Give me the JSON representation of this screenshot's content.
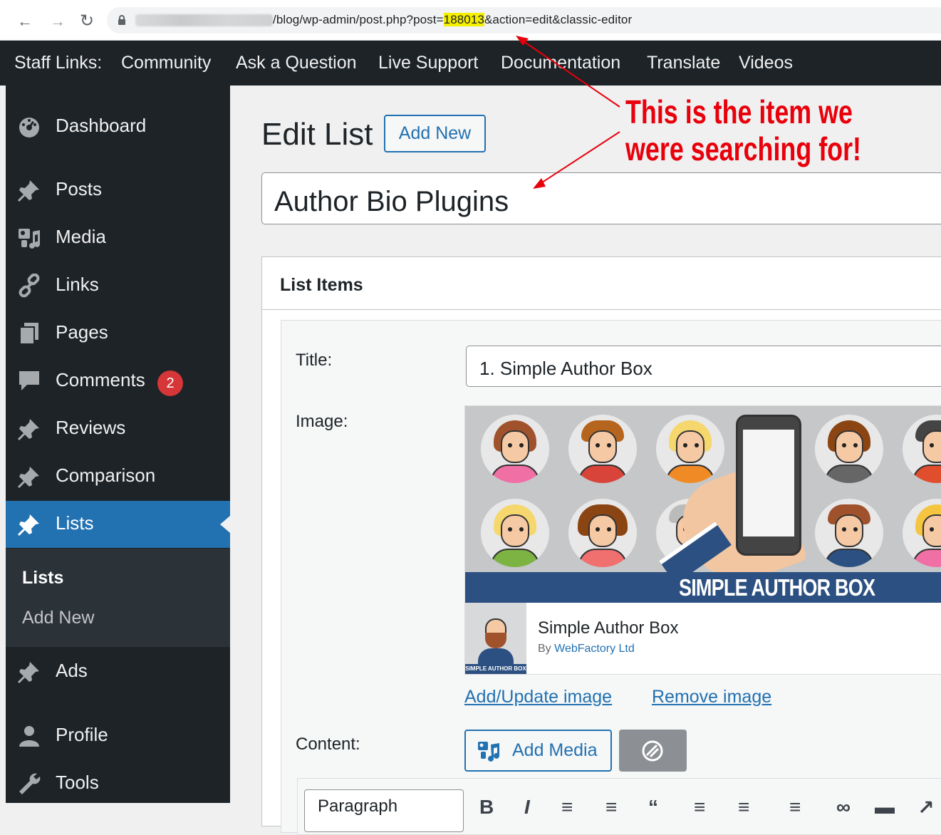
{
  "browser": {
    "back_icon": "arrow-left-icon",
    "forward_icon": "arrow-right-icon",
    "reload_icon": "reload-icon",
    "url_path": "/blog/wp-admin/post.php?post=",
    "url_post_id": "188013",
    "url_query": "&action=edit&classic-editor"
  },
  "adminbar": {
    "items": [
      "Staff Links:",
      "Community",
      "Ask a Question",
      "Live Support",
      "Documentation",
      "Translate",
      "Videos"
    ]
  },
  "sidebar": {
    "items": [
      {
        "label": "Dashboard",
        "icon": "dashboard-icon"
      },
      {
        "label": "Posts",
        "icon": "pin-icon"
      },
      {
        "label": "Media",
        "icon": "media-icon"
      },
      {
        "label": "Links",
        "icon": "link-icon"
      },
      {
        "label": "Pages",
        "icon": "pages-icon"
      },
      {
        "label": "Comments",
        "icon": "comment-icon",
        "badge": "2"
      },
      {
        "label": "Reviews",
        "icon": "pin-icon"
      },
      {
        "label": "Comparison",
        "icon": "pin-icon"
      },
      {
        "label": "Lists",
        "icon": "pin-icon",
        "active": true
      },
      {
        "label": "Ads",
        "icon": "pin-icon"
      },
      {
        "label": "Profile",
        "icon": "user-icon"
      },
      {
        "label": "Tools",
        "icon": "wrench-icon"
      }
    ],
    "submenu": [
      "Lists",
      "Add New"
    ]
  },
  "main": {
    "page_title": "Edit List",
    "add_new_label": "Add New",
    "post_title": "Author Bio Plugins",
    "metabox_title": "List Items",
    "item": {
      "title_label": "Title:",
      "title_value": "1. Simple Author Box",
      "image_label": "Image:",
      "banner_text": "SIMPLE AUTHOR BOX",
      "plugin_name": "Simple Author Box",
      "plugin_by": "By ",
      "plugin_author": "WebFactory Ltd",
      "thumb_text": "SIMPLE AUTHOR BOX",
      "add_update_image": "Add/Update image",
      "remove_image": "Remove image",
      "content_label": "Content:",
      "add_media_label": "Add Media",
      "format_select": "Paragraph"
    }
  },
  "annotation": {
    "line1": "This is the item we",
    "line2": "were searching for!",
    "color": "#e8000b"
  },
  "colors": {
    "admin_dark": "#1d2327",
    "admin_blue": "#2271b1",
    "badge_red": "#d63638",
    "url_highlight": "#f4f000"
  }
}
